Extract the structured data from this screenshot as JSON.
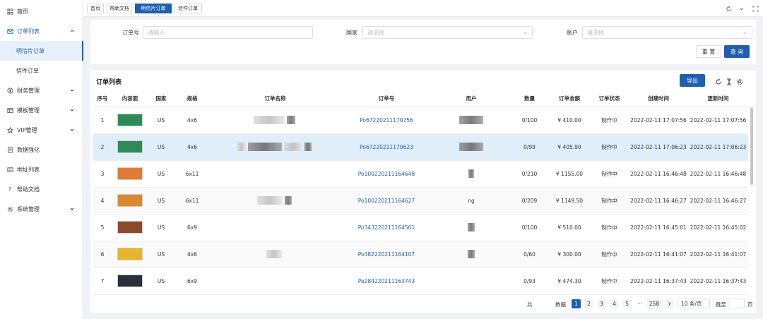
{
  "sidebar": {
    "items": [
      {
        "label": "首页",
        "icon": "grid-icon"
      },
      {
        "label": "订单列表",
        "icon": "mail-icon",
        "open": true,
        "children": [
          {
            "label": "明信片订单",
            "active": true
          },
          {
            "label": "信件订单"
          }
        ]
      },
      {
        "label": "财务管理",
        "icon": "dollar-icon"
      },
      {
        "label": "模板管理",
        "icon": "template-icon"
      },
      {
        "label": "VIP管理",
        "icon": "star-icon"
      },
      {
        "label": "数据强化",
        "icon": "doc-icon"
      },
      {
        "label": "地址列表",
        "icon": "address-icon"
      },
      {
        "label": "帮助文档",
        "icon": "question-icon"
      },
      {
        "label": "系统管理",
        "icon": "gear-icon"
      }
    ]
  },
  "tabs": [
    {
      "label": "首页"
    },
    {
      "label": "帮助文档"
    },
    {
      "label": "明信片订单",
      "active": true
    },
    {
      "label": "信件订单"
    }
  ],
  "filter": {
    "order_no_label": "订单号",
    "order_no_placeholder": "请输入",
    "country_label": "国家",
    "country_placeholder": "请选择",
    "account_label": "账户",
    "account_placeholder": "请选择",
    "reset_label": "重 置",
    "search_label": "查 询"
  },
  "table": {
    "title": "订单列表",
    "export_label": "导出",
    "columns": [
      "序号",
      "内容面",
      "国家",
      "规格",
      "订单名称",
      "订单号",
      "用户",
      "数量",
      "订单金额",
      "订单状态",
      "创建时间",
      "更新时间"
    ],
    "rows": [
      {
        "idx": "1",
        "country": "US",
        "size": "4x6",
        "order_no": "Po67220211170756",
        "user": "",
        "qty": "0/100",
        "amount": "¥ 410.00",
        "status": "制作中",
        "created": "2022-02-11 17:07:56",
        "updated": "2022-02-11 17:07:56",
        "thumb": "#2e8b57"
      },
      {
        "idx": "2",
        "country": "US",
        "size": "4x6",
        "order_no": "Po67220211170623",
        "user": "",
        "qty": "0/99",
        "amount": "¥ 405.90",
        "status": "制作中",
        "created": "2022-02-11 17:06:23",
        "updated": "2022-02-11 17:06:23",
        "thumb": "#2e8b57"
      },
      {
        "idx": "3",
        "country": "US",
        "size": "6x11",
        "order_no": "Po100220211164648",
        "user": "",
        "qty": "0/210",
        "amount": "¥ 1155.00",
        "status": "制作中",
        "created": "2022-02-11 16:46:48",
        "updated": "2022-02-11 16:46:48",
        "thumb": "#e07b39"
      },
      {
        "idx": "4",
        "country": "US",
        "size": "6x11",
        "order_no": "Po100220211164627",
        "user": "ng",
        "qty": "0/209",
        "amount": "¥ 1149.50",
        "status": "制作中",
        "created": "2022-02-11 16:46:27",
        "updated": "2022-02-11 16:46:27",
        "thumb": "#d9892f"
      },
      {
        "idx": "5",
        "country": "US",
        "size": "6x9",
        "order_no": "Po343220211164501",
        "user": "",
        "qty": "0/100",
        "amount": "¥ 510.00",
        "status": "制作中",
        "created": "2022-02-11 16:45:01",
        "updated": "2022-02-11 16:45:02",
        "thumb": "#8b4a2b"
      },
      {
        "idx": "6",
        "country": "US",
        "size": "4x6",
        "order_no": "Po382220211164107",
        "user": "",
        "qty": "0/60",
        "amount": "¥ 300.00",
        "status": "制作中",
        "created": "2022-02-11 16:41:07",
        "updated": "2022-02-11 16:41:07",
        "thumb": "#e6b52c"
      },
      {
        "idx": "7",
        "country": "US",
        "size": "6x9",
        "order_no": "Po284220211163743",
        "user": "",
        "qty": "0/93",
        "amount": "¥ 474.30",
        "status": "制作中",
        "created": "2022-02-11 16:37:43",
        "updated": "2022-02-11 16:37:43",
        "thumb": "#2c2f3a"
      }
    ]
  },
  "pagination": {
    "total_prefix": "共",
    "total_suffix": "数据",
    "pages": [
      "1",
      "2",
      "3",
      "4",
      "5"
    ],
    "ellipsis": "···",
    "last": "258",
    "page_size": "10 条/页",
    "jump_label": "跳至",
    "jump_suffix": "页"
  },
  "colors": {
    "primary": "#1f5fad",
    "selected_row": "#e0eef9"
  }
}
